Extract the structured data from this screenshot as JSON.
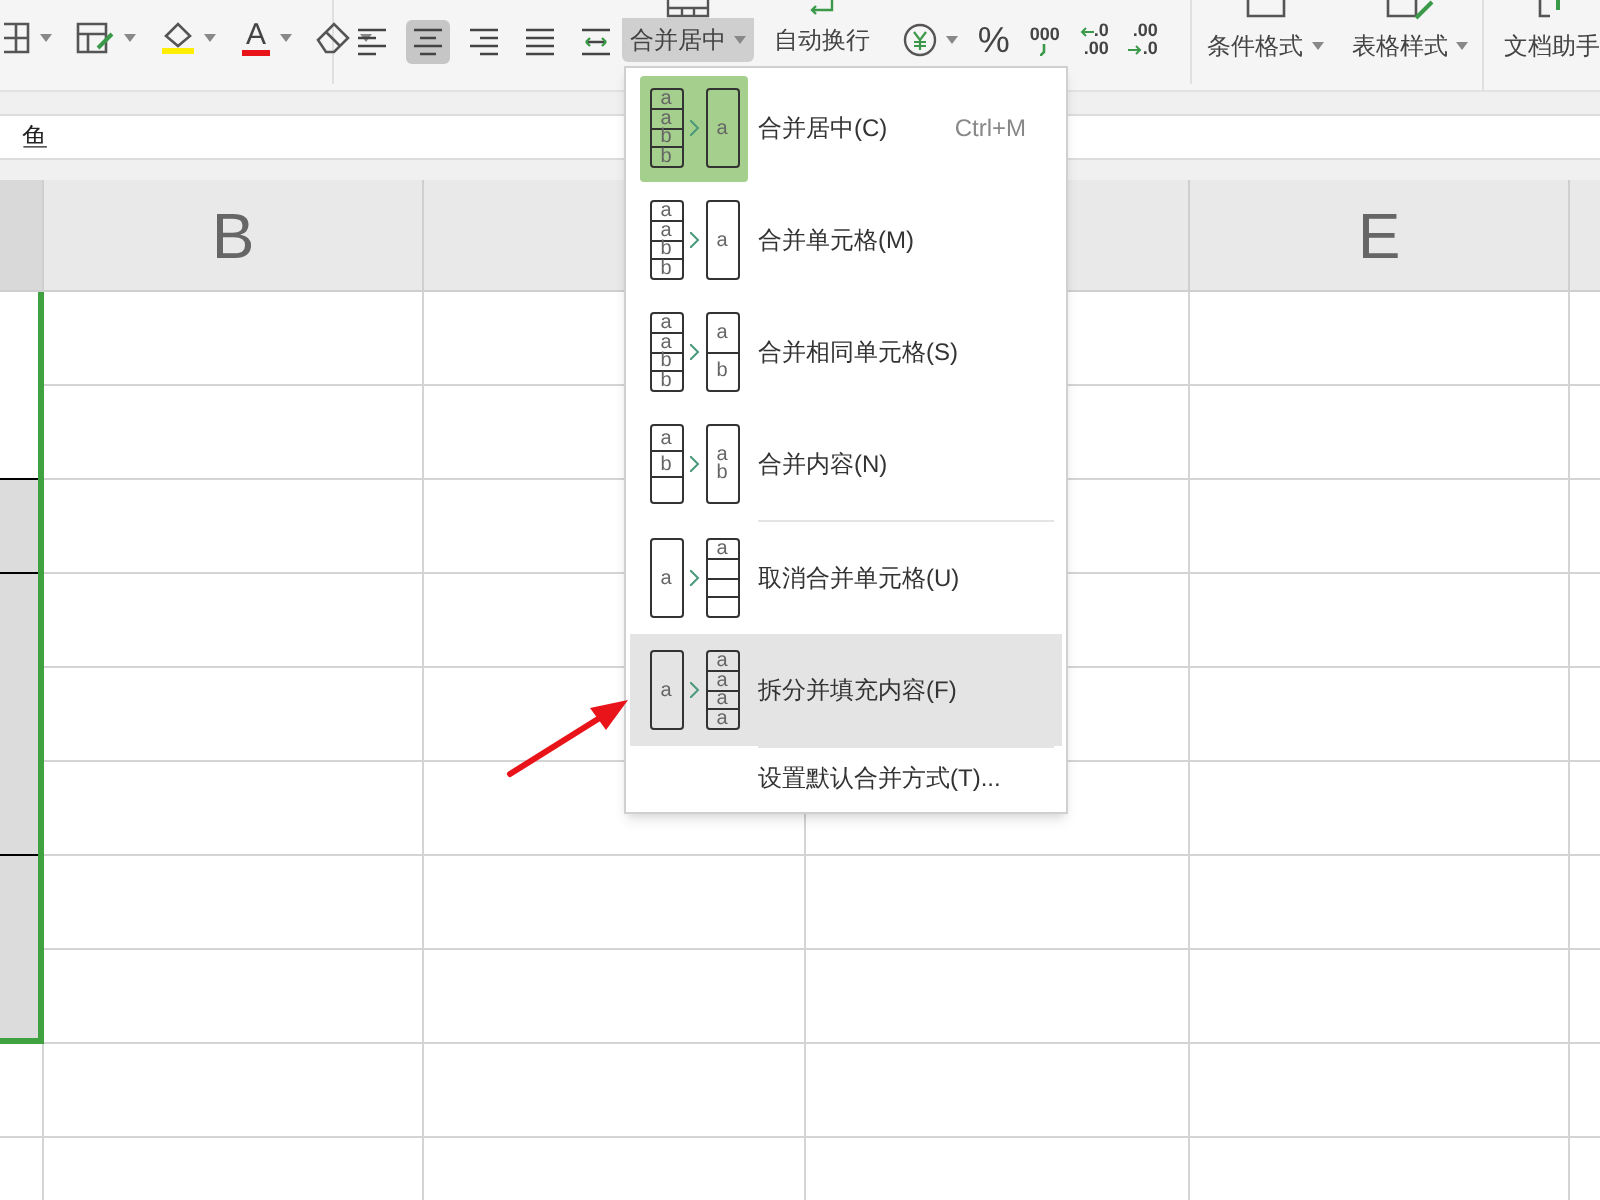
{
  "ribbon": {
    "format_tools": [
      {
        "kind": "borders"
      },
      {
        "kind": "cell_style"
      },
      {
        "kind": "fill_color"
      },
      {
        "kind": "font_color",
        "glyph": "A"
      },
      {
        "kind": "eraser"
      }
    ],
    "align_buttons": [
      {
        "kind": "left",
        "selected": false
      },
      {
        "kind": "center",
        "selected": true
      },
      {
        "kind": "right",
        "selected": false
      },
      {
        "kind": "justify",
        "selected": false
      },
      {
        "kind": "distributed",
        "selected": false
      }
    ],
    "merge_button": {
      "label": "合并居中",
      "open": true
    },
    "wrap_button": {
      "label": "自动换行"
    },
    "number_tools": [
      {
        "kind": "currency"
      },
      {
        "kind": "percent",
        "label": "%"
      },
      {
        "kind": "thousands",
        "label": "000"
      },
      {
        "kind": "increase_decimal",
        "top": ".0",
        "bottom": ".00"
      },
      {
        "kind": "decrease_decimal",
        "top": ".00",
        "bottom": ".0"
      }
    ],
    "style_buttons": [
      {
        "kind": "conditional",
        "label": "条件格式"
      },
      {
        "kind": "table_style",
        "label": "表格样式"
      }
    ],
    "assistant_button": {
      "label": "文档助手"
    }
  },
  "formula_bar": {
    "value": "鱼"
  },
  "sheet": {
    "columns": [
      {
        "selected": true
      },
      {
        "label": "B",
        "selected": false
      },
      {
        "selected": false
      },
      {
        "selected": false
      },
      {
        "label": "E",
        "selected": false
      },
      {
        "selected": false
      }
    ]
  },
  "merge_menu": {
    "items": [
      {
        "label": "合并居中(C)",
        "shortcut": "Ctrl+M",
        "selected": true,
        "hovered": false,
        "separator_before": false,
        "icon": {
          "from": [
            {
              "lines": [
                "a"
              ]
            },
            {
              "lines": [
                "a"
              ]
            },
            {
              "lines": [
                "b"
              ]
            },
            {
              "lines": [
                "b"
              ]
            }
          ],
          "to": [
            {
              "lines": [
                "a"
              ]
            }
          ]
        }
      },
      {
        "label": "合并单元格(M)",
        "selected": false,
        "hovered": false,
        "separator_before": false,
        "icon": {
          "from": [
            {
              "lines": [
                "a"
              ]
            },
            {
              "lines": [
                "a"
              ]
            },
            {
              "lines": [
                "b"
              ]
            },
            {
              "lines": [
                "b"
              ]
            }
          ],
          "to": [
            {
              "lines": [
                "a"
              ]
            }
          ]
        }
      },
      {
        "label": "合并相同单元格(S)",
        "selected": false,
        "hovered": false,
        "separator_before": false,
        "icon": {
          "from": [
            {
              "lines": [
                "a"
              ]
            },
            {
              "lines": [
                "a"
              ]
            },
            {
              "lines": [
                "b"
              ]
            },
            {
              "lines": [
                "b"
              ]
            }
          ],
          "to": [
            {
              "lines": [
                "a"
              ]
            },
            {
              "lines": [
                "b"
              ]
            }
          ]
        }
      },
      {
        "label": "合并内容(N)",
        "selected": false,
        "hovered": false,
        "separator_before": false,
        "icon": {
          "from": [
            {
              "lines": [
                "a"
              ]
            },
            {
              "lines": [
                "b"
              ]
            },
            {
              "kind": "blank"
            }
          ],
          "to": [
            {
              "lines": [
                "a",
                "b"
              ]
            }
          ]
        }
      },
      {
        "label": "取消合并单元格(U)",
        "selected": false,
        "hovered": false,
        "separator_before": true,
        "icon": {
          "from": [
            {
              "lines": [
                "a"
              ]
            }
          ],
          "to": [
            {
              "lines": [
                "a"
              ]
            },
            {
              "kind": "blank"
            },
            {
              "kind": "blank"
            },
            {
              "kind": "blank"
            }
          ]
        }
      },
      {
        "label": "拆分并填充内容(F)",
        "selected": false,
        "hovered": true,
        "separator_before": false,
        "icon": {
          "from": [
            {
              "lines": [
                "a"
              ]
            }
          ],
          "to": [
            {
              "lines": [
                "a"
              ]
            },
            {
              "lines": [
                "a"
              ]
            },
            {
              "lines": [
                "a"
              ]
            },
            {
              "lines": [
                "a"
              ]
            }
          ]
        }
      },
      {
        "label": "设置默认合并方式(T)...",
        "selected": false,
        "hovered": false,
        "separator_before": true
      }
    ]
  }
}
